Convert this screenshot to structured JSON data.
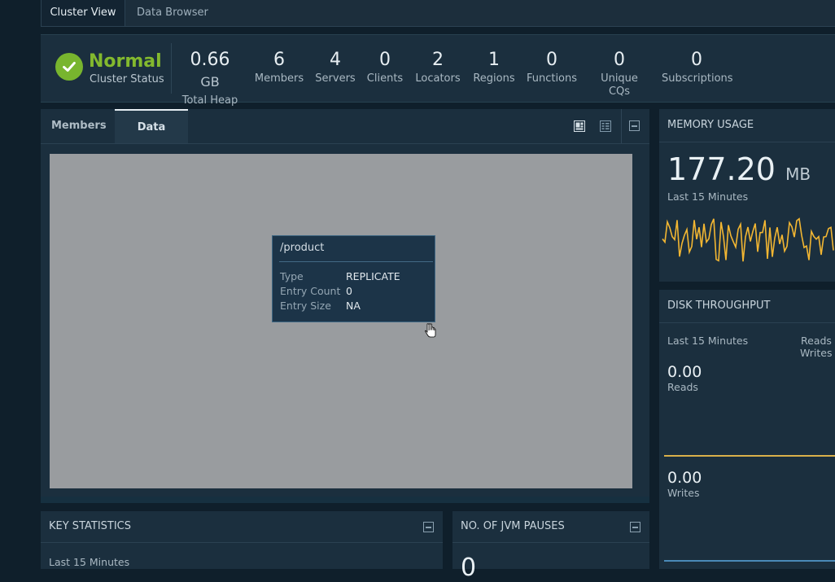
{
  "tabs": {
    "cluster_view": "Cluster View",
    "data_browser": "Data Browser"
  },
  "status": {
    "title": "Normal",
    "subtitle": "Cluster Status"
  },
  "metrics": [
    {
      "value": "0.66",
      "unit": "GB",
      "label": "Total Heap"
    },
    {
      "value": "6",
      "label": "Members"
    },
    {
      "value": "4",
      "label": "Servers"
    },
    {
      "value": "0",
      "label": "Clients"
    },
    {
      "value": "2",
      "label": "Locators"
    },
    {
      "value": "1",
      "label": "Regions"
    },
    {
      "value": "0",
      "label": "Functions"
    },
    {
      "value": "0",
      "label": "Unique CQs"
    },
    {
      "value": "0",
      "label": "Subscriptions"
    }
  ],
  "main": {
    "tab_members": "Members",
    "tab_data": "Data"
  },
  "tooltip": {
    "title": "/product",
    "rows": [
      {
        "key": "Type",
        "value": "REPLICATE"
      },
      {
        "key": "Entry Count",
        "value": "0"
      },
      {
        "key": "Entry Size",
        "value": "NA"
      }
    ]
  },
  "memory": {
    "title": "MEMORY USAGE",
    "value": "177.20",
    "unit": "MB",
    "period": "Last 15 Minutes"
  },
  "disk": {
    "title": "DISK THROUGHPUT",
    "period": "Last 15 Minutes",
    "legend_reads": "Reads",
    "legend_writes": "Writes",
    "reads_value": "0.00",
    "reads_label": "Reads",
    "writes_value": "0.00",
    "writes_label": "Writes"
  },
  "key_stats": {
    "title": "KEY STATISTICS",
    "period": "Last 15 Minutes"
  },
  "jvm": {
    "title": "NO. OF JVM PAUSES",
    "value": "0"
  },
  "colors": {
    "accent_green": "#78b52e",
    "chart_line": "#f2b632",
    "reads_line": "#d9b04a",
    "writes_line": "#4a8ab8"
  }
}
